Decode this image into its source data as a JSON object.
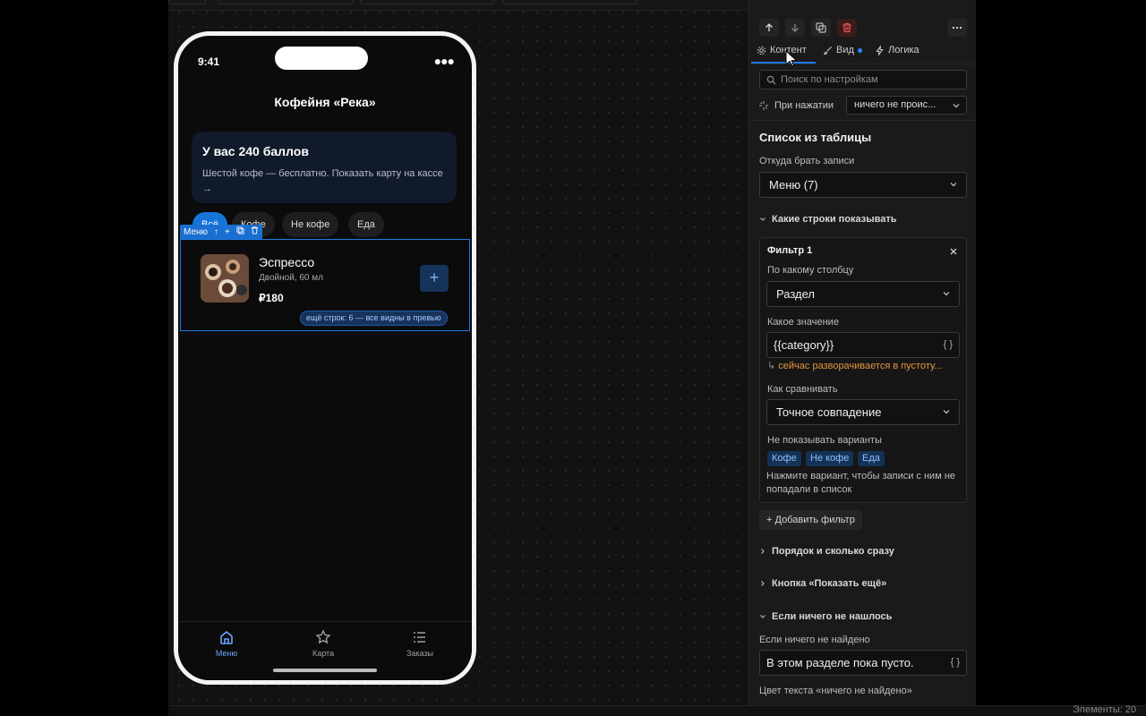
{
  "phone": {
    "time": "9:41",
    "title": "Кофейня «Река»",
    "points_title": "У вас 240 баллов",
    "points_subtitle": "Шестой кофе — бесплатно. Показать карту на кассе →",
    "chips": [
      "Всё",
      "Кофе",
      "Не кофе",
      "Еда"
    ],
    "selection_label": "Меню",
    "item": {
      "name": "Эспрессо",
      "desc": "Двойной, 60 мл",
      "price": "₽180",
      "add": "+"
    },
    "more_rows": "ещё строк: 6 — все видны в превью",
    "tabs": [
      {
        "label": "Меню",
        "icon": "home-icon",
        "active": true
      },
      {
        "label": "Карта",
        "icon": "star-icon",
        "active": false
      },
      {
        "label": "Заказы",
        "icon": "list-icon",
        "active": false
      }
    ]
  },
  "panel": {
    "tabs": [
      "Контент",
      "Вид",
      "Логика"
    ],
    "search_placeholder": "Поиск по настройкам",
    "on_click_label": "При нажатии",
    "on_click_value": "ничего не проис...",
    "section_title": "Список из таблицы",
    "source_label": "Откуда брать записи",
    "source_value": "Меню (7)",
    "rows_section": "Какие строки показывать",
    "filter": {
      "title": "Фильтр 1",
      "column_label": "По какому столбцу",
      "column_value": "Раздел",
      "value_label": "Какое значение",
      "value_value": "{{category}}",
      "value_badge": "{ }",
      "warning": "сейчас разворачивается в пустоту...",
      "compare_label": "Как сравнивать",
      "compare_value": "Точное совпадение",
      "hide_label": "Не показывать варианты",
      "hide_options": [
        "Кофе",
        "Не кофе",
        "Еда"
      ],
      "hint": "Нажмите вариант, чтобы записи с ним не попадали в список"
    },
    "add_filter": "Добавить фильтр",
    "order_section": "Порядок и сколько сразу",
    "more_button_section": "Кнопка «Показать ещё»",
    "empty_section": "Если ничего не нашлось",
    "empty_label": "Если ничего не найдено",
    "empty_value": "В этом разделе пока пусто.",
    "empty_badge": "{ }",
    "color_label": "Цвет текста «ничего не найдено»"
  },
  "status": {
    "elements": "Элементы: 20"
  },
  "colors": {
    "accent": "#1e7be6",
    "warning": "#e3953f",
    "pill_bg": "#143156"
  }
}
